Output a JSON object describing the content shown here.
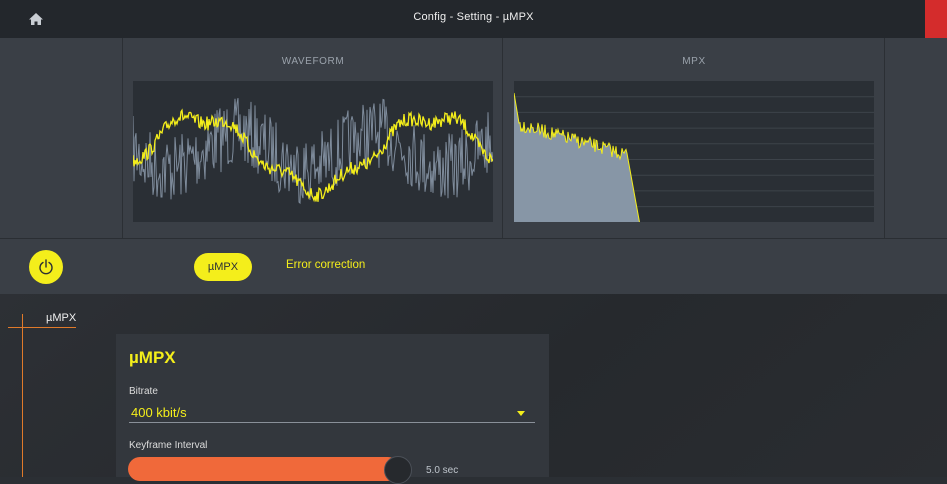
{
  "header": {
    "title": "Config - Setting - µMPX",
    "home_icon": "home-icon"
  },
  "meters": {
    "waveform_label": "WAVEFORM",
    "mpx_label": "MPX"
  },
  "toolbar": {
    "power_icon": "power-icon",
    "tab_active": "µMPX",
    "tab_other": "Error correction"
  },
  "sidebar": {
    "items": [
      {
        "label": "µMPX"
      }
    ]
  },
  "settings": {
    "title": "µMPX",
    "bitrate": {
      "label": "Bitrate",
      "value": "400 kbit/s"
    },
    "keyframe": {
      "label": "Keyframe Interval",
      "value": "5.0 sec"
    }
  },
  "colors": {
    "accent": "#f4ee1b",
    "slider": "#f0693a",
    "close": "#d42c2c"
  }
}
